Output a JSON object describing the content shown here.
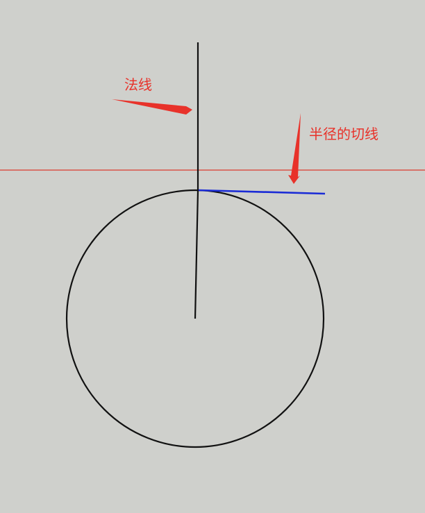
{
  "labels": {
    "normal": "法线",
    "tangent": "半径的切线"
  },
  "colors": {
    "background": "#cfd0cc",
    "annotation": "#e8322a",
    "horizontal_line": "#d93a2e",
    "tangent_segment": "#1a2bd6",
    "stroke": "#111111"
  }
}
